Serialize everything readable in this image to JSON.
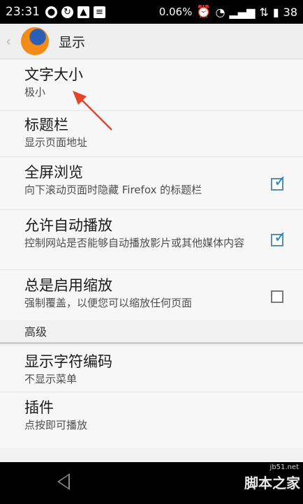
{
  "status_bar": {
    "time": "23:31",
    "network_speed": "0.06%",
    "battery": "38",
    "icons": [
      "notification-icon",
      "sync-icon",
      "image-icon",
      "doc-icon",
      "alarm-icon",
      "wifi-icon",
      "signal-icon",
      "network-icon"
    ]
  },
  "action_bar": {
    "title": "显示"
  },
  "prefs": [
    {
      "title": "文字大小",
      "summary": "极小"
    },
    {
      "title": "标题栏",
      "summary": "显示页面地址"
    },
    {
      "title": "全屏浏览",
      "summary": "向下滚动页面时隐藏 Firefox 的标题栏",
      "checked": true
    },
    {
      "title": "允许自动播放",
      "summary": "控制网站是否能够自动播放影片或其他媒体内容",
      "checked": true
    },
    {
      "title": "总是启用缩放",
      "summary": "强制覆盖，以便您可以缩放任何页面",
      "checked": false
    }
  ],
  "section_header": "高级",
  "advanced_prefs": [
    {
      "title": "显示字符编码",
      "summary": "不显示菜单"
    },
    {
      "title": "插件",
      "summary": "点按即可播放"
    }
  ],
  "watermark": {
    "main": "脚本之家",
    "small": "jb51.net"
  },
  "colors": {
    "annotation_arrow": "#e8432a",
    "checkbox_tick": "#1e8ad6",
    "status_bar": "#000000"
  }
}
